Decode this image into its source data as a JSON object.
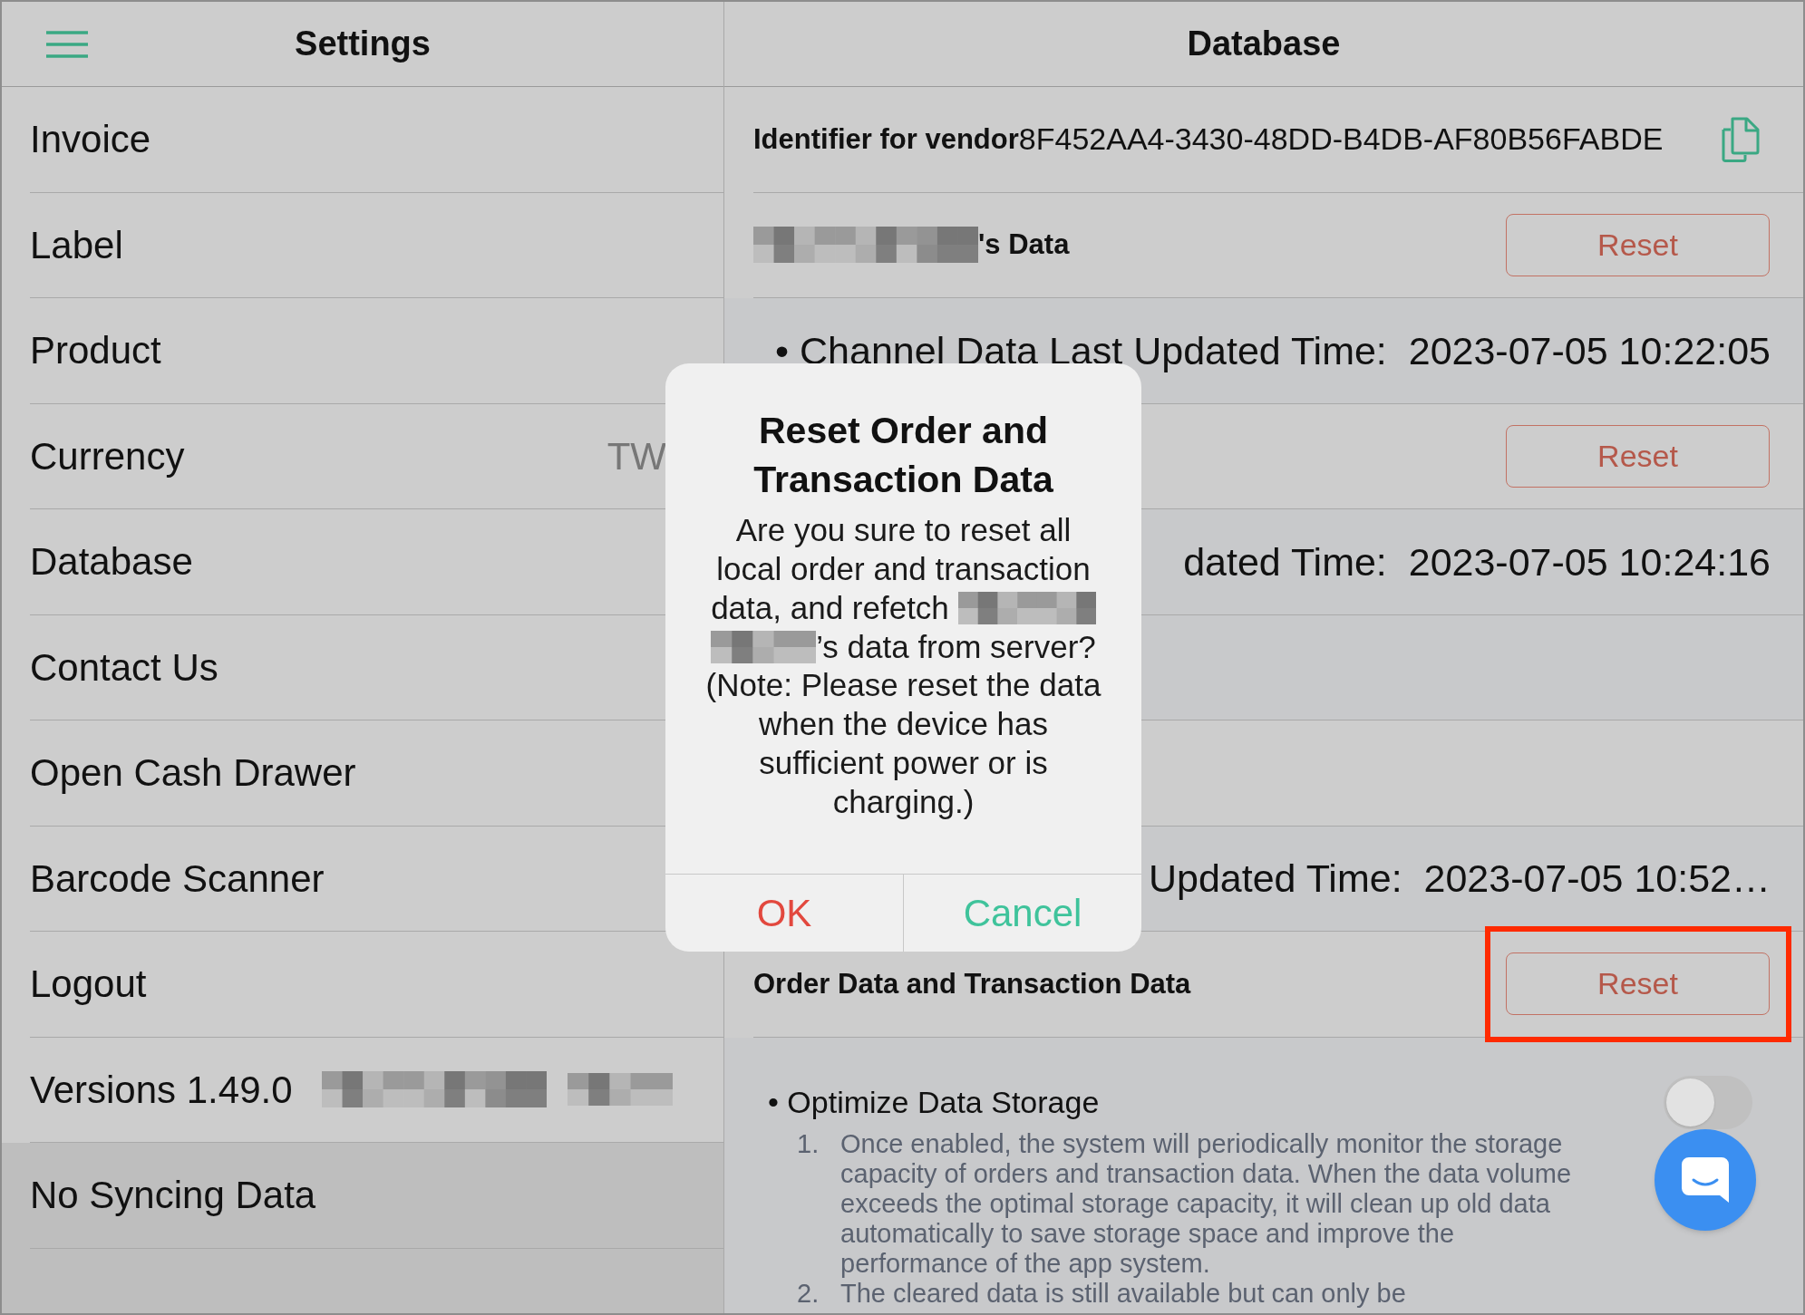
{
  "sidebar": {
    "title": "Settings",
    "items": [
      {
        "label": "Invoice"
      },
      {
        "label": "Label"
      },
      {
        "label": "Product"
      },
      {
        "label": "Currency",
        "value": "TW"
      },
      {
        "label": "Database"
      },
      {
        "label": "Contact Us"
      },
      {
        "label": "Open Cash Drawer"
      },
      {
        "label": "Barcode Scanner"
      },
      {
        "label": "Logout"
      },
      {
        "label": "Versions 1.49.0",
        "redactions": [
          {
            "kind": "pixelated"
          },
          {
            "kind": "pixelated"
          }
        ]
      }
    ],
    "footer": "No Syncing Data"
  },
  "detail": {
    "title": "Database",
    "rows": [
      {
        "kind": "identifier",
        "label": "Identifier for vendor",
        "value": "8F452AA4-3430-48DD-B4DB-AF80B56FABDE"
      },
      {
        "kind": "section",
        "label_parts": [
          {
            "kind": "redaction"
          },
          {
            "kind": "text",
            "text": "'s Data"
          }
        ],
        "button": "Reset",
        "highlighted": false
      },
      {
        "kind": "detail",
        "text": "• Channel Data Last Updated Time:  2023-07-05 10:22:05"
      },
      {
        "kind": "section",
        "button": "Reset",
        "highlighted": false
      },
      {
        "kind": "detail",
        "text": "dated Time:  2023-07-05 10:24:16"
      },
      {
        "kind": "detail"
      },
      {
        "kind": "section"
      },
      {
        "kind": "detail",
        "text": "Updated Time:  2023-07-05 10:52…"
      },
      {
        "kind": "section",
        "label_parts": [
          {
            "kind": "text",
            "text": "Order Data and Transaction Data"
          }
        ],
        "button": "Reset",
        "highlighted": true
      }
    ],
    "optimize": {
      "label": "• Optimize Data Storage",
      "on": false,
      "notes": [
        {
          "number": "1.",
          "text": "Once enabled, the system will periodically monitor the storage capacity of orders and transaction data. When the data volume exceeds the optimal storage capacity, it will clean up old data automatically to save storage space and improve the performance of the app system."
        },
        {
          "number": "2.",
          "text": "The cleared data is still available but can only be"
        }
      ]
    }
  },
  "dialog": {
    "title": "Reset Order and Transaction Data",
    "message_lines": [
      [
        {
          "kind": "text",
          "text": "Are you sure to reset all"
        }
      ],
      [
        {
          "kind": "text",
          "text": "local order and transaction"
        }
      ],
      [
        {
          "kind": "text",
          "text": "data, and refetch"
        },
        {
          "kind": "redaction"
        }
      ],
      [
        {
          "kind": "redaction"
        },
        {
          "kind": "text",
          "text": "’s data from server?"
        }
      ],
      [
        {
          "kind": "text",
          "text": "(Note: Please reset the data"
        }
      ],
      [
        {
          "kind": "text",
          "text": "when the device has"
        }
      ],
      [
        {
          "kind": "text",
          "text": "sufficient power or is"
        }
      ],
      [
        {
          "kind": "text",
          "text": "charging.)"
        }
      ]
    ],
    "buttons": [
      {
        "label": "OK",
        "kind": "confirm"
      },
      {
        "label": "Cancel",
        "kind": "cancel"
      }
    ]
  }
}
